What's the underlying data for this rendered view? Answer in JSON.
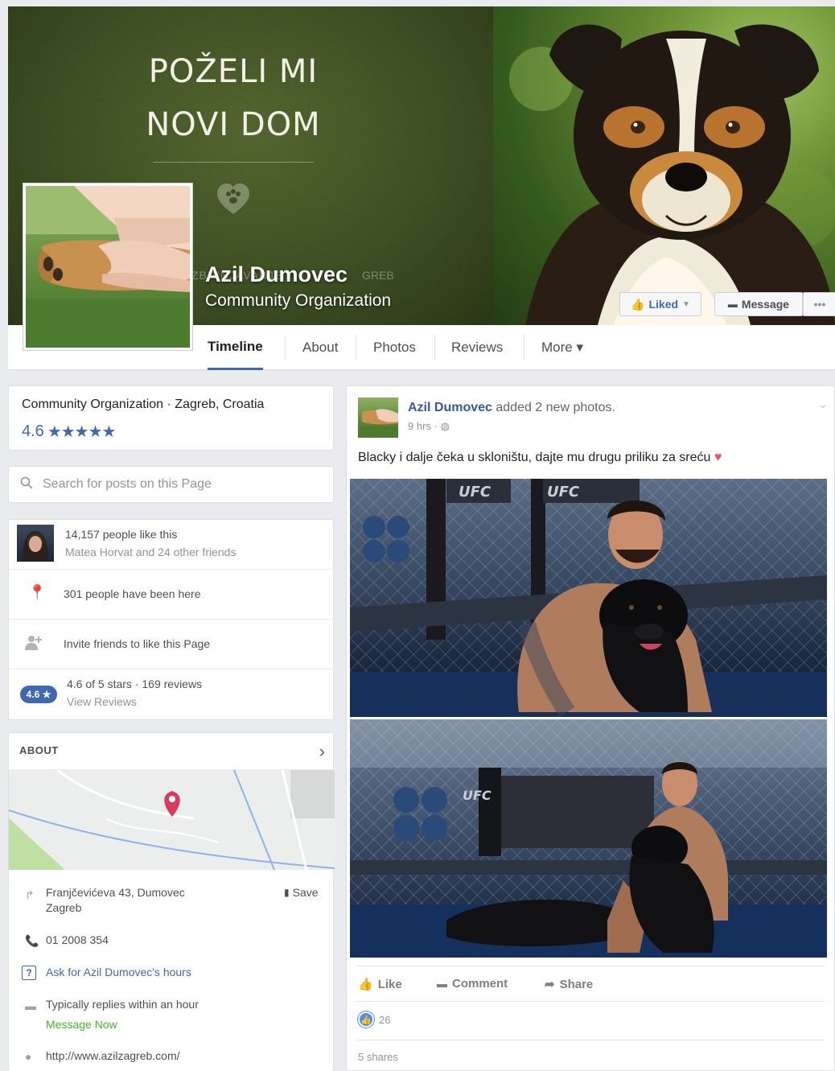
{
  "cover": {
    "title_line1": "POŽELI MI",
    "title_line2": "NOVI DOM",
    "overlay_left": "ZBRINJAVANJE",
    "overlay_right": "GREB",
    "buttons": {
      "liked": "Liked",
      "message": "Message",
      "more": "•••"
    }
  },
  "page": {
    "name": "Azil Dumovec",
    "category": "Community Organization"
  },
  "nav": {
    "tabs": [
      {
        "label": "Timeline",
        "active": true
      },
      {
        "label": "About"
      },
      {
        "label": "Photos"
      },
      {
        "label": "Reviews"
      },
      {
        "label": "More ▾"
      }
    ]
  },
  "summary": {
    "category_location": "Community Organization · Zagreb, Croatia",
    "rating": "4.6",
    "stars": "★★★★★"
  },
  "search": {
    "placeholder": "Search for posts on this Page"
  },
  "stats": {
    "likes": "14,157 people like this",
    "likes_friends": "Matea Horvat and 24 other friends",
    "checkins": "301 people have been here",
    "invite": "Invite friends to like this Page",
    "rating_badge": "4.6 ★",
    "rating_text": "4.6 of 5 stars · 169 reviews",
    "view_reviews": "View Reviews"
  },
  "about": {
    "title": "ABOUT",
    "address_line1": "Franjčevićeva 43, Dumovec",
    "address_line2": "Zagreb",
    "save": "Save",
    "phone": "01 2008 354",
    "hours_link": "Ask for Azil Dumovec's hours",
    "replies": "Typically replies within an hour",
    "message_now": "Message Now",
    "website": "http://www.azilzagreb.com/"
  },
  "post": {
    "author": "Azil Dumovec",
    "action": " added 2 new photos.",
    "time": "9 hrs · ",
    "text": "Blacky i dalje čeka u skloništu, dajte mu drugu priliku za sreću",
    "actions": {
      "like": "Like",
      "comment": "Comment",
      "share": "Share"
    },
    "reactions_count": "26",
    "shares": "5 shares",
    "photo_text": {
      "ufc1": "UFC",
      "ufc2": "UFC",
      "ufc3": "UFC"
    }
  },
  "colors": {
    "brand_blue": "#4267b2",
    "link_blue": "#365899",
    "green": "#42b72a"
  }
}
